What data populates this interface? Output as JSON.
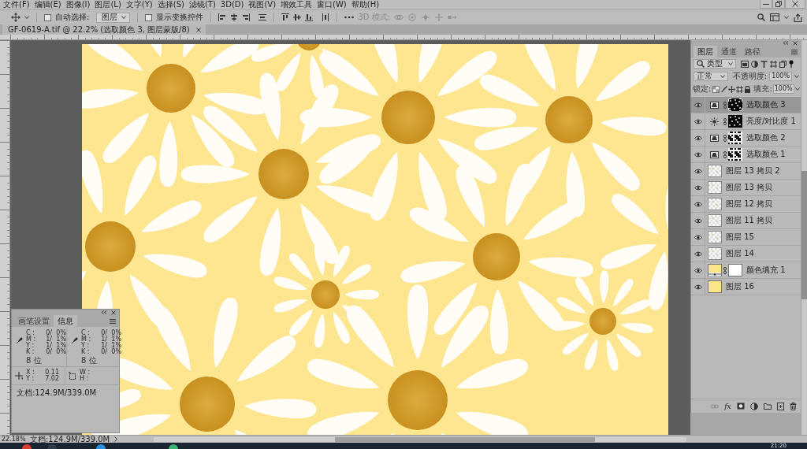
{
  "menu": [
    "文件(F)",
    "编辑(E)",
    "图像(I)",
    "图层(L)",
    "文字(Y)",
    "选择(S)",
    "滤镜(T)",
    "3D(D)",
    "视图(V)",
    "增效工具",
    "窗口(W)",
    "帮助(H)"
  ],
  "options_bar": {
    "auto_select": {
      "label": "自动选择:",
      "checked": false
    },
    "target": "图层",
    "show_transform": {
      "label": "显示变换控件",
      "checked": false
    },
    "mode_3d": {
      "label": "3D 模式:",
      "disabled": true
    }
  },
  "document_tab": {
    "title": "GF-0619-A.tif @ 22.2% (选取颜色 3, 图层蒙版/8)",
    "selected": true
  },
  "info_panel": {
    "tabs": [
      {
        "label": "画笔设置",
        "selected": false
      },
      {
        "label": "信息",
        "selected": true
      }
    ],
    "color_readouts": [
      {
        "channels": [
          {
            "label": "C :",
            "value": "0/",
            "percent": "0%"
          },
          {
            "label": "M :",
            "value": "1/",
            "percent": "1%"
          },
          {
            "label": "Y :",
            "value": "1/",
            "percent": "1%"
          },
          {
            "label": "K :",
            "value": "0/",
            "percent": "0%"
          }
        ],
        "bit_depth": "8 位"
      },
      {
        "channels": [
          {
            "label": "C :",
            "value": "0/",
            "percent": "0%"
          },
          {
            "label": "M :",
            "value": "1/",
            "percent": "1%"
          },
          {
            "label": "Y :",
            "value": "1/",
            "percent": "1%"
          },
          {
            "label": "K :",
            "value": "0/",
            "percent": "0%"
          }
        ],
        "bit_depth": "8 位"
      }
    ],
    "position": [
      {
        "label": "X :",
        "value": "0.11"
      },
      {
        "label": "Y :",
        "value": "7.02"
      }
    ],
    "size": [
      {
        "label": "W :"
      },
      {
        "label": "H :"
      }
    ],
    "document": "文档:124.9M/339.0M"
  },
  "layers_panel": {
    "tabs": [
      {
        "label": "图层",
        "selected": true
      },
      {
        "label": "通道",
        "selected": false
      },
      {
        "label": "路径",
        "selected": false
      }
    ],
    "filter": "类型",
    "blend_mode": "正常",
    "opacity": {
      "label": "不透明度:",
      "value": "100%"
    },
    "lock_label": "锁定:",
    "fill": {
      "label": "填充:",
      "value": "100%"
    },
    "layers": [
      {
        "name": "选取颜色 3",
        "kind": "selective_color",
        "visible": true,
        "selected": true,
        "mask": {
          "kind": "spots"
        }
      },
      {
        "name": "亮度/对比度 1",
        "kind": "brightness",
        "visible": true,
        "selected": false,
        "mask": {
          "kind": "spots"
        }
      },
      {
        "name": "选取颜色 2",
        "kind": "selective_color",
        "visible": true,
        "selected": false,
        "mask": {
          "kind": "noise"
        }
      },
      {
        "name": "选取颜色 1",
        "kind": "selective_color",
        "visible": true,
        "selected": false,
        "mask": {
          "kind": "noise"
        }
      },
      {
        "name": "图层 13 拷贝 2",
        "kind": "pixel",
        "visible": true,
        "selected": false
      },
      {
        "name": "图层 13 拷贝",
        "kind": "pixel",
        "visible": true,
        "selected": false
      },
      {
        "name": "图层 12 拷贝",
        "kind": "pixel",
        "visible": true,
        "selected": false
      },
      {
        "name": "图层 11 拷贝",
        "kind": "pixel",
        "visible": true,
        "selected": false
      },
      {
        "name": "图层 15",
        "kind": "pixel",
        "visible": true,
        "selected": false
      },
      {
        "name": "图层 14",
        "kind": "pixel",
        "visible": true,
        "selected": false
      },
      {
        "name": "颜色填充 1",
        "kind": "fill",
        "visible": true,
        "selected": false,
        "color": "#fde68a",
        "mask": {
          "kind": "white"
        }
      },
      {
        "name": "图层 16",
        "kind": "pixel",
        "visible": true,
        "selected": false,
        "color": "#fde68a"
      }
    ],
    "style_button": "fx"
  },
  "status_bar": {
    "zoom": "22.18%",
    "document": "文档:124.9M/339.0M"
  },
  "taskbar": {
    "time": "21:20"
  }
}
